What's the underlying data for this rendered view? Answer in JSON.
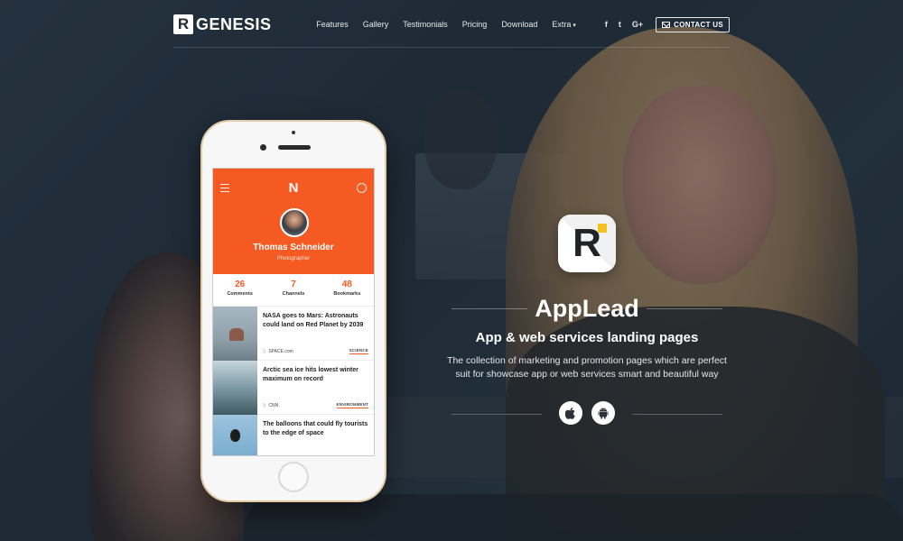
{
  "brand": {
    "logo_mark": "R",
    "name": "GENESIS"
  },
  "nav": {
    "items": [
      {
        "label": "Features"
      },
      {
        "label": "Gallery"
      },
      {
        "label": "Testimonials"
      },
      {
        "label": "Pricing"
      },
      {
        "label": "Download"
      },
      {
        "label": "Extra"
      }
    ],
    "social": {
      "facebook": "f",
      "twitter": "t",
      "google_plus": "G+"
    },
    "contact_label": "CONTACT US"
  },
  "hero": {
    "app_icon_letter": "R",
    "title": "AppLead",
    "subtitle": "App & web services landing pages",
    "description": "The collection of marketing and promotion pages which are perfect suit for showcase app or web services smart and beautiful way",
    "store_icons": [
      "apple-icon",
      "android-icon"
    ]
  },
  "phone": {
    "app_logo": "N",
    "profile": {
      "name": "Thomas Schneider",
      "role": "Photographer"
    },
    "stats": [
      {
        "value": "26",
        "label": "Comments"
      },
      {
        "value": "7",
        "label": "Channels"
      },
      {
        "value": "48",
        "label": "Bookmarks"
      }
    ],
    "news": [
      {
        "title": "NASA goes to Mars: Astronauts could land on Red Planet by 2039",
        "source": "SPACE.com",
        "tag": "SCIENCE"
      },
      {
        "title": "Arctic sea ice hits lowest winter maximum on record",
        "source": "CNN",
        "tag": "ENVIRONMENT"
      },
      {
        "title": "The balloons that could fly tourists to the edge of space",
        "source": "",
        "tag": ""
      }
    ]
  },
  "colors": {
    "accent": "#f45a21",
    "app_icon_accent": "#f4c21f",
    "overlay": "#1f2a33"
  }
}
